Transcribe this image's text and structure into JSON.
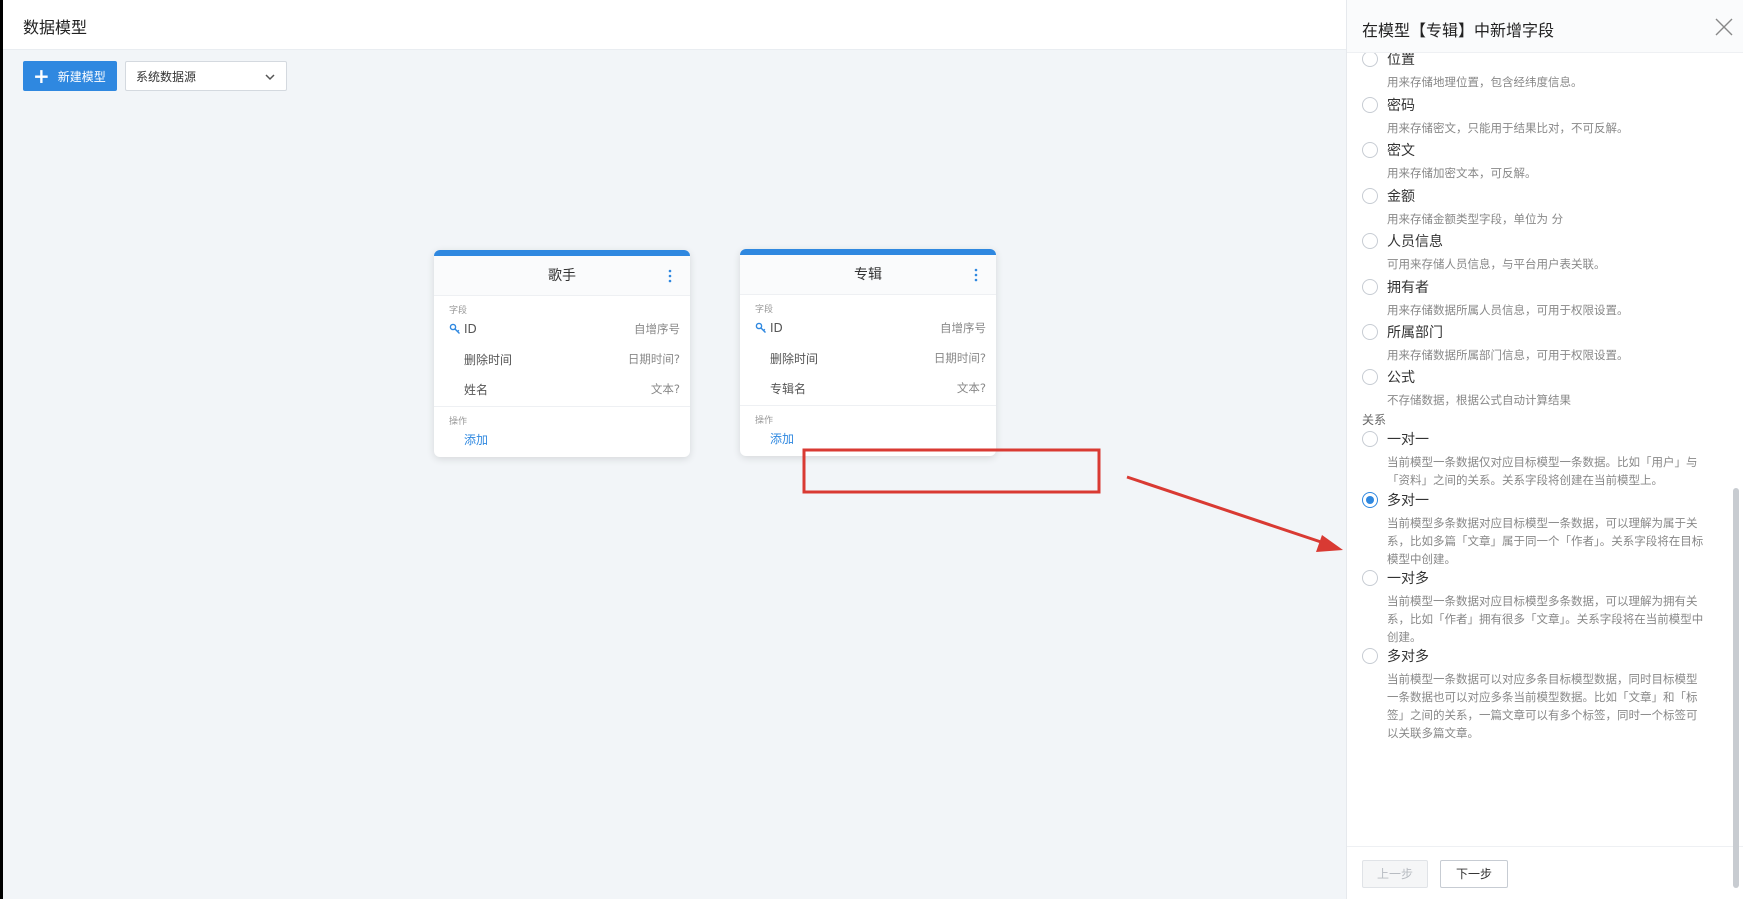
{
  "header": {
    "title": "数据模型"
  },
  "toolbar": {
    "new_model_label": "新建模型",
    "datasource_selected": "系统数据源"
  },
  "models": [
    {
      "title": "歌手",
      "fields_label": "字段",
      "fields": [
        {
          "name": "ID",
          "type": "自增序号",
          "key": true
        },
        {
          "name": "删除时间",
          "type": "日期时间?"
        },
        {
          "name": "姓名",
          "type": "文本?"
        }
      ],
      "actions_label": "操作",
      "add_label": "添加"
    },
    {
      "title": "专辑",
      "fields_label": "字段",
      "fields": [
        {
          "name": "ID",
          "type": "自增序号",
          "key": true
        },
        {
          "name": "删除时间",
          "type": "日期时间?"
        },
        {
          "name": "专辑名",
          "type": "文本?"
        }
      ],
      "actions_label": "操作",
      "add_label": "添加"
    }
  ],
  "panel": {
    "title": "在模型【专辑】中新增字段",
    "options": [
      {
        "label": "位置",
        "desc": "用来存储地理位置，包含经纬度信息。"
      },
      {
        "label": "密码",
        "desc": "用来存储密文，只能用于结果比对，不可反解。"
      },
      {
        "label": "密文",
        "desc": "用来存储加密文本，可反解。"
      },
      {
        "label": "金额",
        "desc": "用来存储金额类型字段，单位为 分"
      },
      {
        "label": "人员信息",
        "desc": "可用来存储人员信息，与平台用户表关联。"
      },
      {
        "label": "拥有者",
        "desc": "用来存储数据所属人员信息，可用于权限设置。"
      },
      {
        "label": "所属部门",
        "desc": "用来存储数据所属部门信息，可用于权限设置。"
      },
      {
        "label": "公式",
        "desc": "不存储数据，根据公式自动计算结果"
      }
    ],
    "relation_group_label": "关系",
    "relations": [
      {
        "label": "一对一",
        "desc": "当前模型一条数据仅对应目标模型一条数据。比如「用户」与「资料」之间的关系。关系字段将创建在当前模型上。",
        "selected": false
      },
      {
        "label": "多对一",
        "desc": "当前模型多条数据对应目标模型一条数据，可以理解为属于关系，比如多篇「文章」属于同一个「作者」。关系字段将在目标模型中创建。",
        "selected": true
      },
      {
        "label": "一对多",
        "desc": "当前模型一条数据对应目标模型多条数据，可以理解为拥有关系，比如「作者」拥有很多「文章」。关系字段将在当前模型中创建。",
        "selected": false
      },
      {
        "label": "多对多",
        "desc": "当前模型一条数据可以对应多条目标模型数据，同时目标模型一条数据也可以对应多条当前模型数据。比如「文章」和「标签」之间的关系，一篇文章可以有多个标签，同时一个标签可以关联多篇文章。",
        "selected": false
      }
    ],
    "prev_label": "上一步",
    "next_label": "下一步"
  },
  "colors": {
    "accent": "#2f88e0",
    "annotation": "#d93a33"
  }
}
